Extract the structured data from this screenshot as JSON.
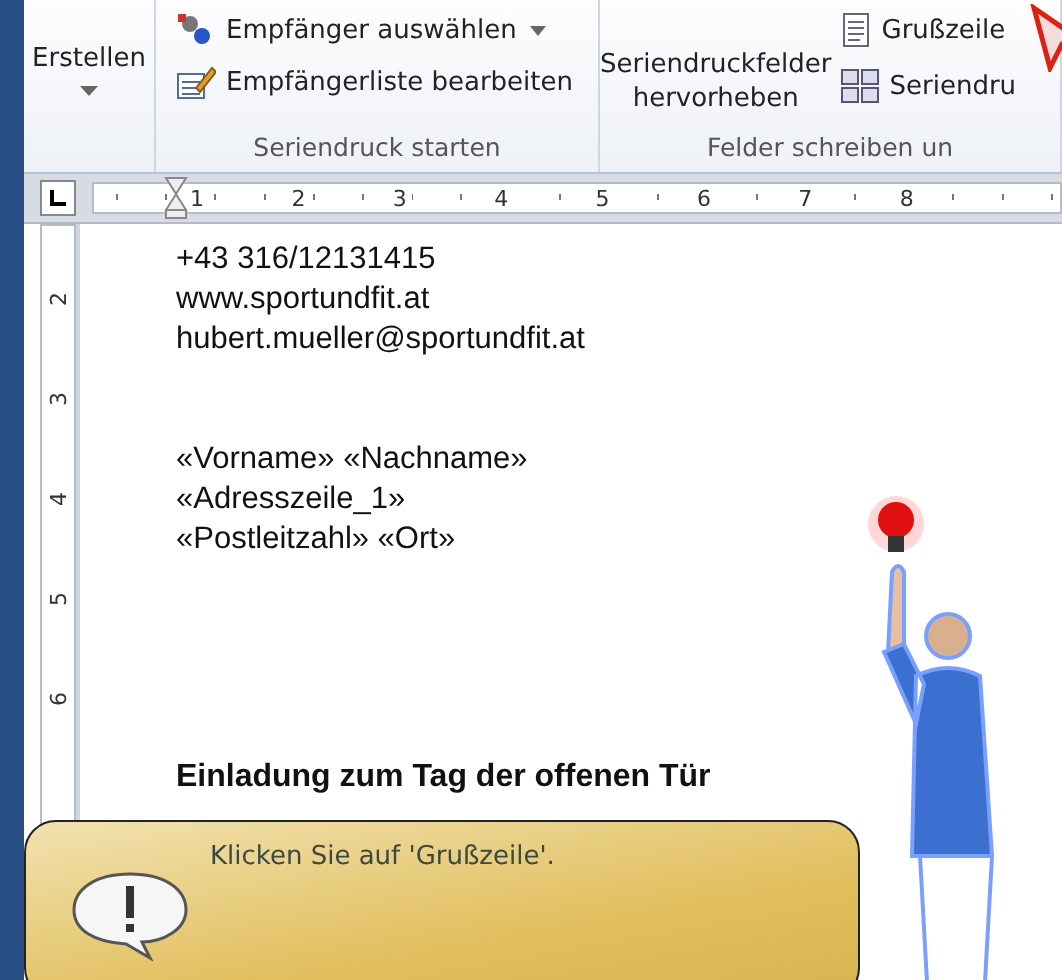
{
  "ribbon": {
    "create": {
      "label": "Erstellen"
    },
    "start_group": {
      "items": [
        {
          "label": "Empfänger auswählen",
          "has_dropdown": true
        },
        {
          "label": "Empfängerliste bearbeiten",
          "has_dropdown": false
        }
      ],
      "title": "Seriendruck starten"
    },
    "fields_group": {
      "highlight_label": "Seriendruckfelder hervorheben",
      "items": [
        {
          "label": "Grußzeile"
        },
        {
          "label": "Seriendru"
        }
      ],
      "title": "Felder schreiben un"
    }
  },
  "ruler": {
    "numbers": [
      "1",
      "2",
      "3",
      "4",
      "5",
      "6",
      "7",
      "8"
    ]
  },
  "vertical_ruler": {
    "numbers": [
      "2",
      "3",
      "4",
      "5",
      "6"
    ]
  },
  "document": {
    "contact_lines": [
      "+43 316/12131415",
      "www.sportundfit.at",
      "hubert.mueller@sportundfit.at"
    ],
    "merge_lines": [
      "«Vorname» «Nachname»",
      "«Adresszeile_1»",
      "«Postleitzahl» «Ort»"
    ],
    "heading": "Einladung zum Tag der offenen Tür"
  },
  "assistant": {
    "balloon_text": "Klicken Sie auf 'Grußzeile'."
  }
}
